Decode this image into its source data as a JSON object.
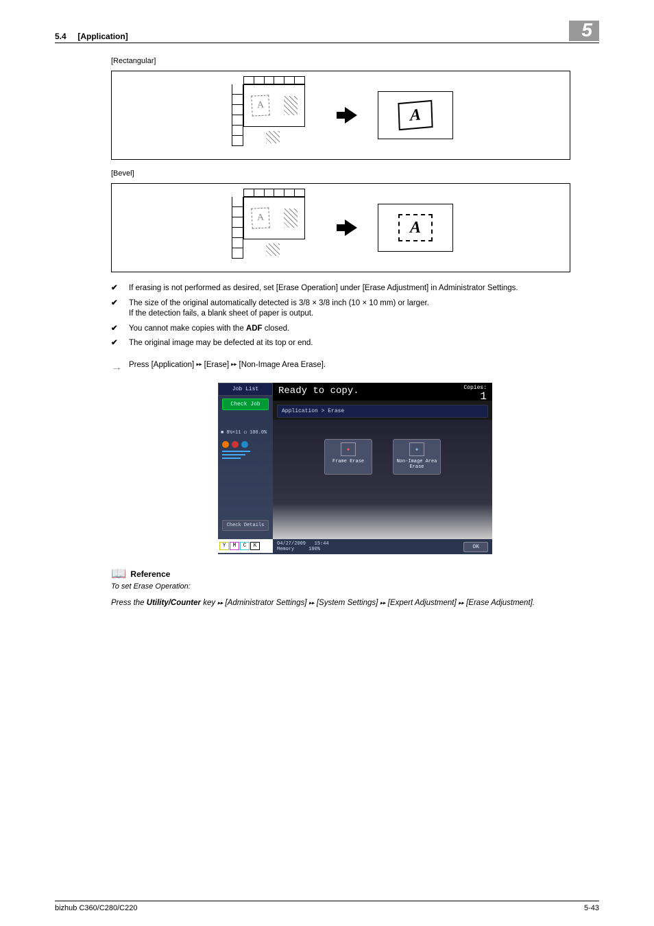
{
  "header": {
    "section_number": "5.4",
    "section_title": "[Application]",
    "chapter_number": "5"
  },
  "labels": {
    "rectangular": "[Rectangular]",
    "bevel": "[Bevel]"
  },
  "bullets": {
    "b1": "If erasing is not performed as desired, set [Erase Operation] under [Erase Adjustment] in Administrator Settings.",
    "b2a": "The size of the original automatically detected is 3/8 × 3/8 inch (10 × 10 mm) or larger.",
    "b2b": "If the detection fails, a blank sheet of paper is output.",
    "b3_pre": "You cannot make copies with the ",
    "b3_bold": "ADF",
    "b3_post": " closed.",
    "b4": "The original image may be defected at its top or end."
  },
  "nav_instruction": {
    "prefix": "Press [Application] ",
    "mid1": " [Erase] ",
    "mid2": " [Non-Image Area Erase]."
  },
  "screen": {
    "job_list": "Job List",
    "check_job": "Check Job",
    "status_pct": "100.0%",
    "check_details": "Check Details",
    "ready": "Ready to copy.",
    "copies_label": "Copies:",
    "copies_value": "1",
    "breadcrumb": "Application > Erase",
    "btn_frame_erase": "Frame Erase",
    "btn_nonimage": "Non-Image Area Erase",
    "footer_date": "04/27/2009",
    "footer_time": "15:44",
    "footer_mem": "Memory",
    "footer_mem_pct": "100%",
    "ok": "OK",
    "y": "Y",
    "m": "M",
    "c": "C",
    "k": "K"
  },
  "reference": {
    "heading": "Reference",
    "subtitle": "To set Erase Operation:",
    "body_pre": "Press the ",
    "body_bold": "Utility/Counter",
    "body_post1": " key ",
    "seg1": " [Administrator Settings] ",
    "seg2": " [System Settings] ",
    "seg3": " [Expert Adjustment] ",
    "seg4": " [Erase Adjustment]."
  },
  "footer": {
    "left": "bizhub C360/C280/C220",
    "right": "5-43"
  },
  "glyph_a": "A"
}
